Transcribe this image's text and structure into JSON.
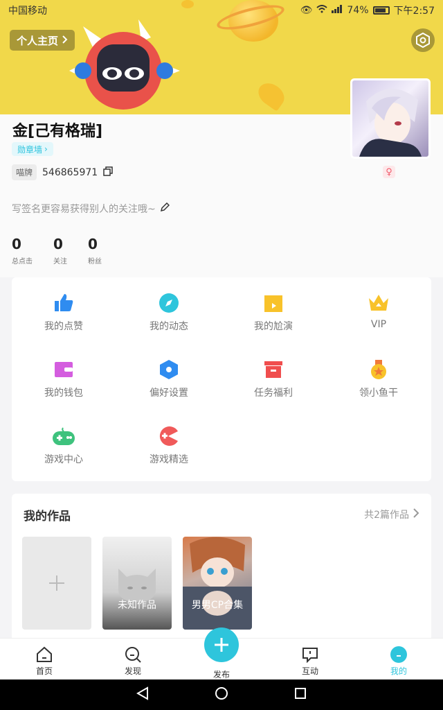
{
  "status_bar": {
    "carrier": "中国移动",
    "signal_text": "⁴ᴳ",
    "battery": "74%",
    "time": "下午2:57"
  },
  "header": {
    "profile_button": "个人主页"
  },
  "profile": {
    "username": "金[己有格瑞]",
    "badge_wall": "勋章墙",
    "id_tag": "喵牌",
    "id_value": "546865971",
    "signature": "写签名更容易获得别人的关注哦~",
    "gender": "♀",
    "stats": [
      {
        "num": "0",
        "label": "总点击"
      },
      {
        "num": "0",
        "label": "关注"
      },
      {
        "num": "0",
        "label": "粉丝"
      }
    ]
  },
  "grid": [
    {
      "label": "我的点赞",
      "icon": "thumbs-up-icon",
      "color": "#2f8cf0"
    },
    {
      "label": "我的动态",
      "icon": "compass-icon",
      "color": "#2ec5dc"
    },
    {
      "label": "我的尬演",
      "icon": "video-icon",
      "color": "#f8c22a"
    },
    {
      "label": "VIP",
      "icon": "crown-icon",
      "color": "#f8c22a"
    },
    {
      "label": "我的钱包",
      "icon": "wallet-icon",
      "color": "#d45ddf"
    },
    {
      "label": "偏好设置",
      "icon": "hexagon-icon",
      "color": "#2f8cf0"
    },
    {
      "label": "任务福利",
      "icon": "gift-box-icon",
      "color": "#f04e4e"
    },
    {
      "label": "领小鱼干",
      "icon": "medal-icon",
      "color": "#f8c22a"
    },
    {
      "label": "游戏中心",
      "icon": "gamepad-icon",
      "color": "#3ec27d"
    },
    {
      "label": "游戏精选",
      "icon": "pacman-icon",
      "color": "#f05a5a"
    }
  ],
  "works": {
    "title": "我的作品",
    "count_text": "共2篇作品",
    "items": [
      {
        "label": "未知作品"
      },
      {
        "label": "男男CP合集"
      }
    ]
  },
  "nav": [
    {
      "label": "首页",
      "icon": "home-icon"
    },
    {
      "label": "发现",
      "icon": "discover-icon"
    },
    {
      "label": "发布",
      "icon": "plus-icon"
    },
    {
      "label": "互动",
      "icon": "chat-icon"
    },
    {
      "label": "我的",
      "icon": "me-icon"
    }
  ],
  "colors": {
    "accent": "#2ec5dc",
    "banner": "#f1d84a"
  }
}
